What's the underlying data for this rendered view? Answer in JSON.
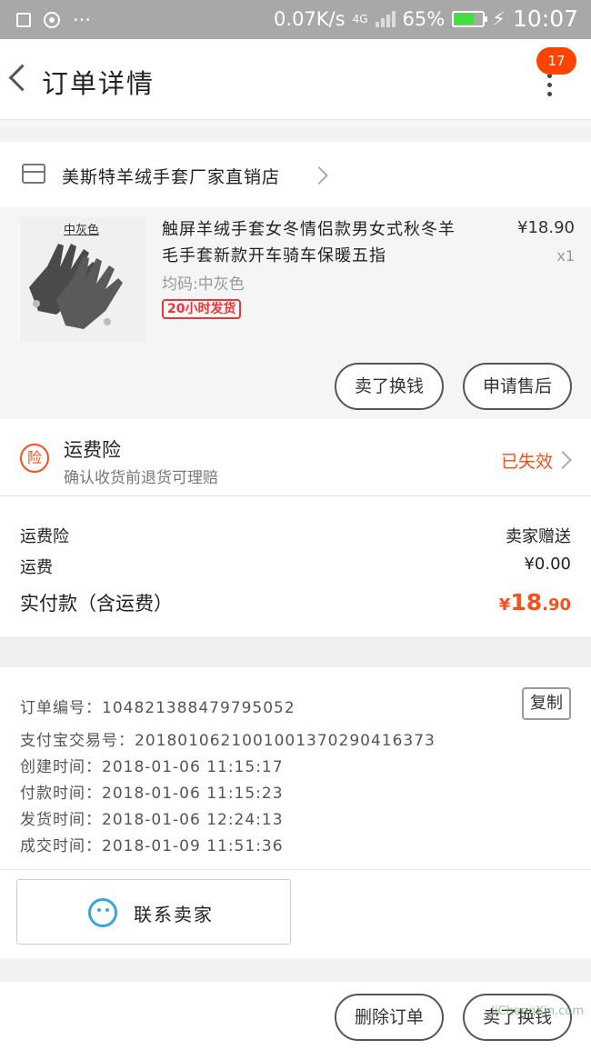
{
  "status_bar": {
    "network_speed": "0.07K/s",
    "network_type": "4G",
    "battery": "65%",
    "time": "10:07"
  },
  "header": {
    "title": "订单详情",
    "badge_count": "17"
  },
  "shop": {
    "name": "美斯特羊绒手套厂家直销店"
  },
  "item": {
    "thumb_tag": "中灰色",
    "title": "触屏羊绒手套女冬情侣款男女式秋冬羊毛手套新款开车骑车保暖五指",
    "price": "¥18.90",
    "quantity": "x1",
    "sku": "均码:中灰色",
    "ship_tag": "20小时发货",
    "btn_exchange": "卖了换钱",
    "btn_aftersale": "申请售后"
  },
  "insurance": {
    "icon_char": "险",
    "title": "运费险",
    "subtitle": "确认收货前退货可理赔",
    "status": "已失效"
  },
  "fees": {
    "insurance_label": "运费险",
    "insurance_value": "卖家赠送",
    "shipping_label": "运费",
    "shipping_value": "¥0.00",
    "total_label": "实付款（含运费）",
    "total_currency": "¥",
    "total_int": "18",
    "total_dec": ".90"
  },
  "order_info": {
    "order_no": "订单编号：104821388479795052",
    "copy_label": "复制",
    "alipay_no": "支付宝交易号：2018010621001001370290416373",
    "created": "创建时间：2018-01-06 11:15:17",
    "paid": "付款时间：2018-01-06 11:15:23",
    "shipped": "发货时间：2018-01-06 12:24:13",
    "completed": "成交时间：2018-01-09 11:51:36",
    "contact_label": "联系卖家"
  },
  "footer": {
    "delete_label": "删除订单",
    "exchange_label": "卖了换钱"
  },
  "watermark": "JiChengXin.com",
  "colors": {
    "accent": "#f4511e",
    "badge": "#ff4400",
    "contact_icon": "#3aa3e3"
  }
}
